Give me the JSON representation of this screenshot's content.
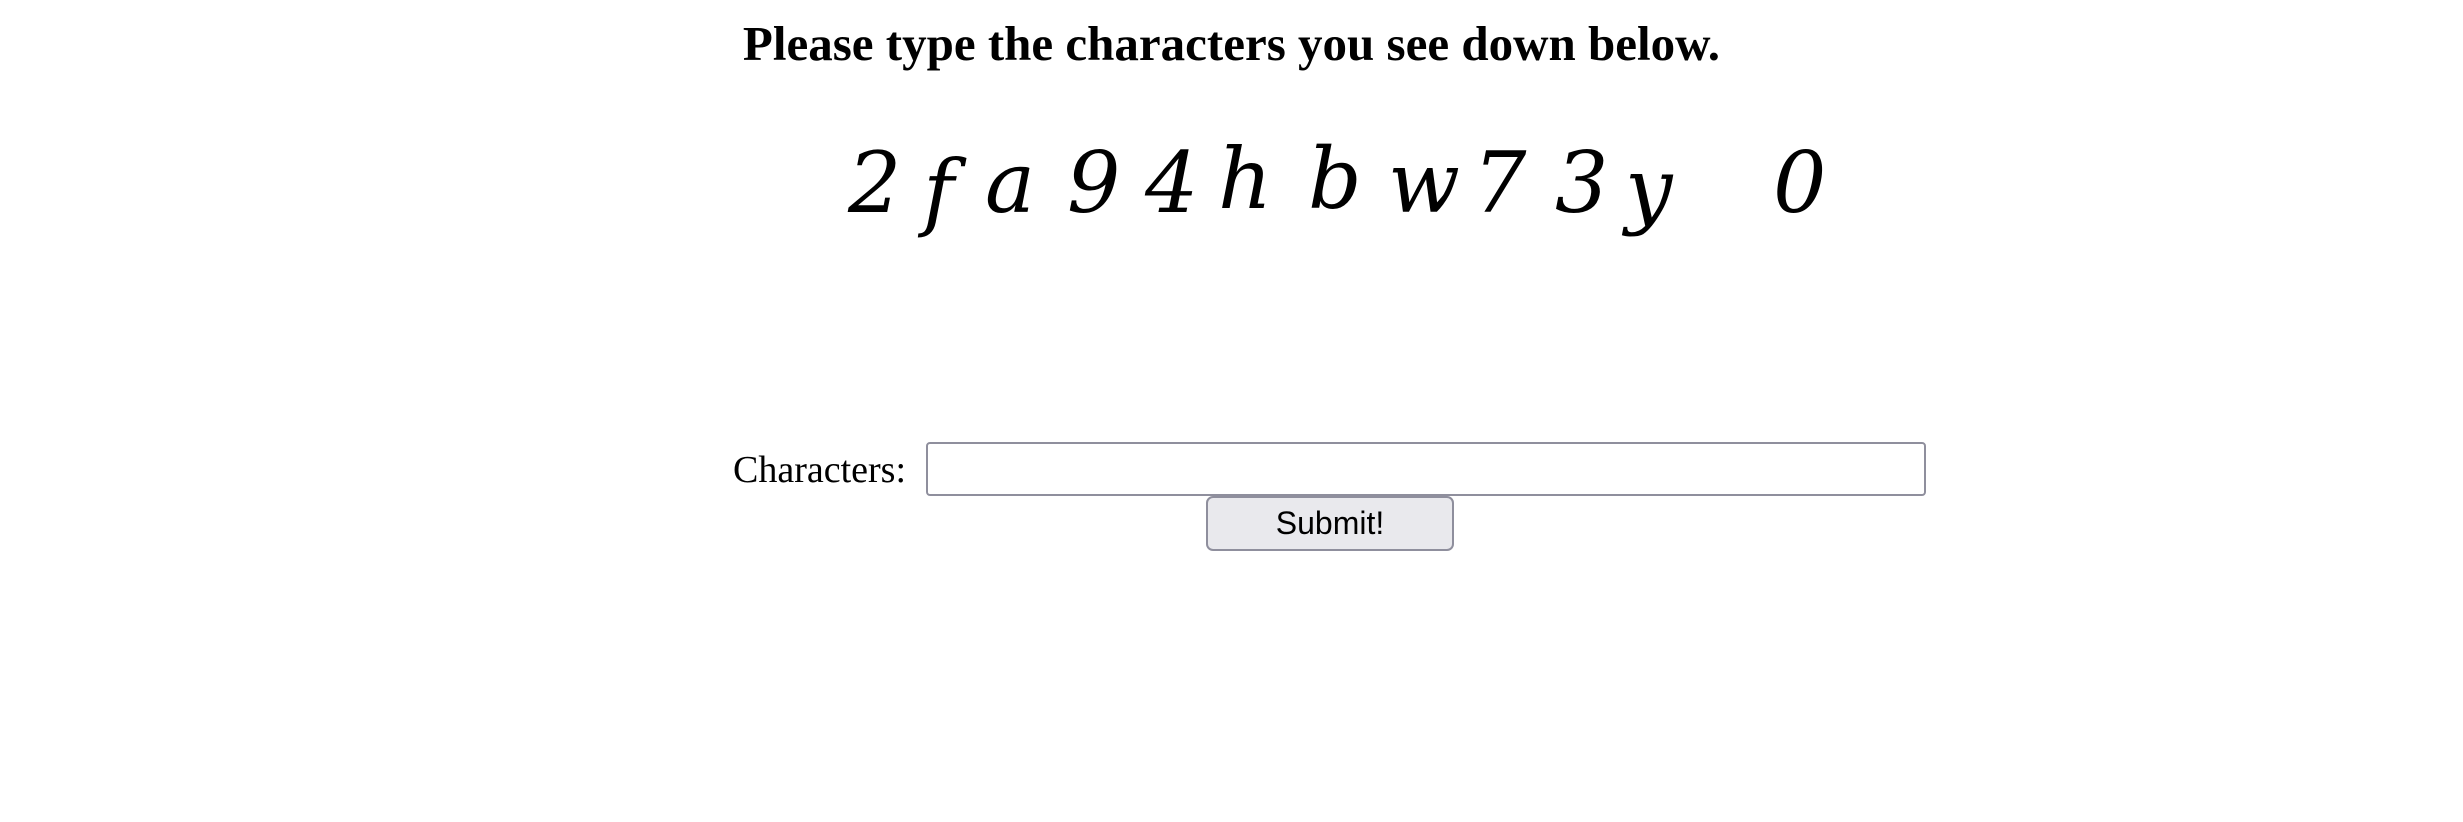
{
  "heading": "Please type the characters you see down below.",
  "captcha": {
    "characters": [
      "2",
      "f",
      "a",
      "9",
      "4",
      "h",
      "b",
      "w",
      "7",
      "3",
      "y",
      "0"
    ]
  },
  "form": {
    "label": "Characters:",
    "input_value": "",
    "input_placeholder": "",
    "submit_label": "Submit!"
  }
}
